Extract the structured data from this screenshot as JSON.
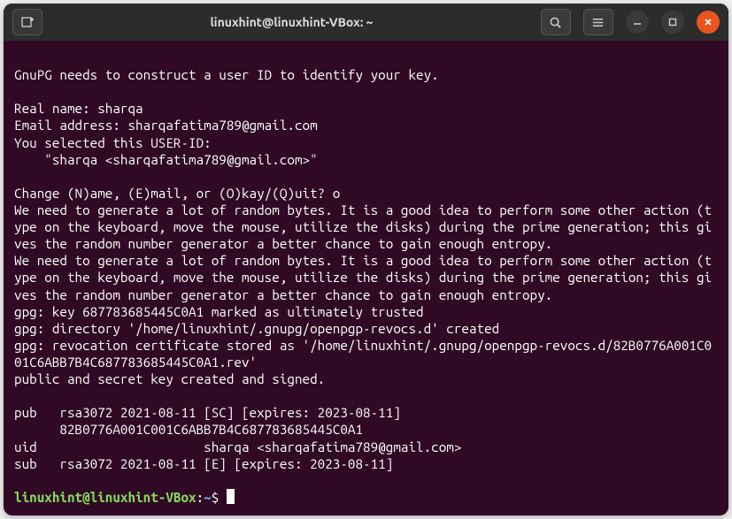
{
  "titlebar": {
    "title": "linuxhint@linuxhint-VBox: ~"
  },
  "terminal": {
    "lines": {
      "l1": "GnuPG needs to construct a user ID to identify your key.",
      "l2": "Real name: sharqa",
      "l3": "Email address: sharqafatima789@gmail.com",
      "l4": "You selected this USER-ID:",
      "l5": "    \"sharqa <sharqafatima789@gmail.com>\"",
      "l6": "Change (N)ame, (E)mail, or (O)kay/(Q)uit? o",
      "l7": "We need to generate a lot of random bytes. It is a good idea to perform some other action (type on the keyboard, move the mouse, utilize the disks) during the prime generation; this gives the random number generator a better chance to gain enough entropy.",
      "l8": "We need to generate a lot of random bytes. It is a good idea to perform some other action (type on the keyboard, move the mouse, utilize the disks) during the prime generation; this gives the random number generator a better chance to gain enough entropy.",
      "l9": "gpg: key 687783685445C0A1 marked as ultimately trusted",
      "l10": "gpg: directory '/home/linuxhint/.gnupg/openpgp-revocs.d' created",
      "l11": "gpg: revocation certificate stored as '/home/linuxhint/.gnupg/openpgp-revocs.d/82B0776A001C001C6ABB7B4C687783685445C0A1.rev'",
      "l12": "public and secret key created and signed.",
      "l13": "pub   rsa3072 2021-08-11 [SC] [expires: 2023-08-11]",
      "l14": "      82B0776A001C001C6ABB7B4C687783685445C0A1",
      "l15": "uid                      sharqa <sharqafatima789@gmail.com>",
      "l16": "sub   rsa3072 2021-08-11 [E] [expires: 2023-08-11]"
    },
    "prompt": {
      "user": "linuxhint@linuxhint-VBox",
      "colon": ":",
      "path": "~",
      "dollar": "$ "
    }
  }
}
